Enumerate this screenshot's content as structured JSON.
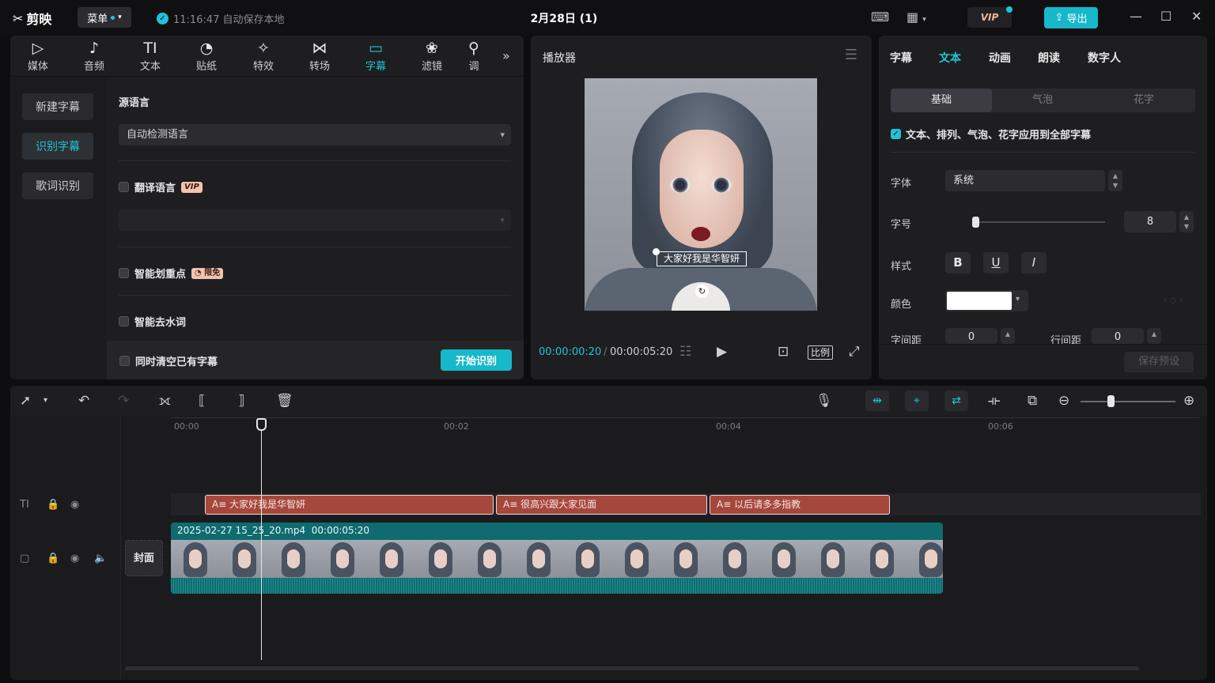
{
  "titlebar": {
    "logo": "剪映",
    "menu_label": "菜单",
    "autosave": "11:16:47 自动保存本地",
    "project_title": "2月28日 (1)",
    "vip_label": "VIP",
    "export_label": "导出"
  },
  "tools": [
    {
      "label": "媒体",
      "icon": "media-icon"
    },
    {
      "label": "音频",
      "icon": "audio-icon"
    },
    {
      "label": "文本",
      "icon": "text-icon"
    },
    {
      "label": "贴纸",
      "icon": "sticker-icon"
    },
    {
      "label": "特效",
      "icon": "effects-icon"
    },
    {
      "label": "转场",
      "icon": "transition-icon"
    },
    {
      "label": "字幕",
      "icon": "subtitle-icon"
    },
    {
      "label": "滤镜",
      "icon": "filter-icon"
    },
    {
      "label": "调",
      "icon": "adjust-icon"
    }
  ],
  "left_nav": {
    "new_subtitle": "新建字幕",
    "recognize_subtitle": "识别字幕",
    "lyric_recognize": "歌词识别"
  },
  "recognize": {
    "source_lang_label": "源语言",
    "source_lang_value": "自动检测语言",
    "translate_label": "翻译语言",
    "translate_badge": "VIP",
    "highlight_label": "智能划重点",
    "highlight_badge": "限免",
    "remove_filler_label": "智能去水词",
    "clear_existing_label": "同时清空已有字幕",
    "start_button": "开始识别"
  },
  "player": {
    "title": "播放器",
    "subtitle_text": "大家好我是华智妍",
    "current_time": "00:00:00:20",
    "separator": "/",
    "total_time": "00:00:05:20",
    "ratio_label": "比例"
  },
  "right_panel": {
    "tabs": [
      "字幕",
      "文本",
      "动画",
      "朗读",
      "数字人"
    ],
    "active_tab": "文本",
    "segments": [
      "基础",
      "气泡",
      "花字"
    ],
    "apply_all": "文本、排列、气泡、花字应用到全部字幕",
    "font_label": "字体",
    "font_value": "系统",
    "size_label": "字号",
    "size_value": "8",
    "style_label": "样式",
    "color_label": "颜色",
    "color_value": "#ffffff",
    "letter_spacing_label": "字间距",
    "letter_spacing_value": "0",
    "line_spacing_label": "行间距",
    "line_spacing_value": "0",
    "save_preset": "保存预设"
  },
  "timeline": {
    "ruler": [
      "00:00",
      "00:02",
      "00:04",
      "00:06"
    ],
    "subtitle_clips": [
      "大家好我是华智妍",
      "很高兴跟大家见面",
      "以后请多多指教"
    ],
    "video_clip_name": "2025-02-27 15_25_20.mp4",
    "video_clip_duration": "00:00:05:20",
    "cover_label": "封面"
  },
  "colors": {
    "accent": "#21c3d6",
    "subtitle_clip": "#a6473c",
    "video_clip": "#0f6b70"
  }
}
